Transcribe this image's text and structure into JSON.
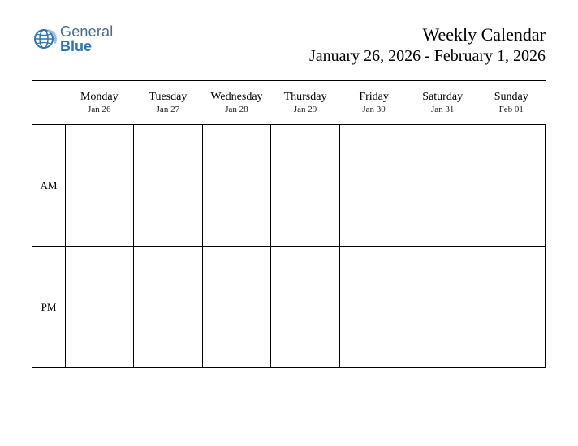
{
  "logo": {
    "word1": "General",
    "word2": "Blue"
  },
  "title": "Weekly Calendar",
  "date_range": "January 26, 2026 - February 1, 2026",
  "days": [
    {
      "name": "Monday",
      "date": "Jan 26"
    },
    {
      "name": "Tuesday",
      "date": "Jan 27"
    },
    {
      "name": "Wednesday",
      "date": "Jan 28"
    },
    {
      "name": "Thursday",
      "date": "Jan 29"
    },
    {
      "name": "Friday",
      "date": "Jan 30"
    },
    {
      "name": "Saturday",
      "date": "Jan 31"
    },
    {
      "name": "Sunday",
      "date": "Feb 01"
    }
  ],
  "periods": [
    "AM",
    "PM"
  ]
}
